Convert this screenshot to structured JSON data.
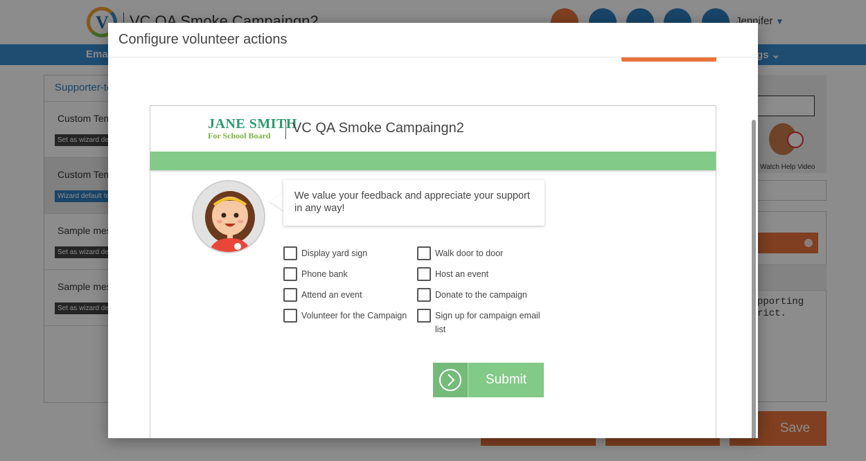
{
  "background": {
    "app_title": "VC QA Smoke Campaingn2",
    "user_name": "Jennifer",
    "nav_left": "Ema",
    "nav_right": "gs ⌄",
    "panel_header": "Supporter-te",
    "panel_items": [
      {
        "label": "Custom Tem",
        "tag": "Set as wizard def"
      },
      {
        "label": "Custom Tem",
        "tag": "Wizard default te"
      },
      {
        "label": "Sample mes",
        "tag": "Set as wizard def"
      },
      {
        "label": "Sample mes",
        "tag": "Set as wizard def"
      }
    ],
    "help_caption": "Watch Help Video",
    "snippet_text": "pporting\nrict.",
    "save_label": "Save"
  },
  "modal": {
    "title": "Configure volunteer actions",
    "preview": {
      "brand_line1": "JANE SMITH",
      "brand_line2": "For School Board",
      "campaign_title": "VC QA Smoke Campaingn2",
      "message": "We value your feedback and appreciate your support in any way!",
      "actions_col1": [
        "Display yard sign",
        "Phone bank",
        "Attend an event",
        "Volunteer for the Campaign"
      ],
      "actions_col2": [
        "Walk door to door",
        "Host an event",
        "Donate to the campaign",
        "Sign up for campaign email list"
      ],
      "submit_label": "Submit"
    }
  },
  "colors": {
    "accent_green": "#82ca87",
    "brand_blue": "#3a8ccf",
    "orange": "#e8743b"
  },
  "icons": [
    "logo-icon",
    "document-icon",
    "help-icon",
    "binoculars-icon",
    "search-icon",
    "user-icon",
    "play-icon",
    "close-icon",
    "chevron-right-icon"
  ]
}
